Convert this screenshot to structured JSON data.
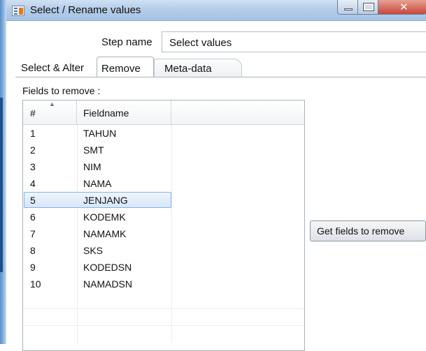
{
  "window": {
    "title": "Select / Rename values"
  },
  "step": {
    "label": "Step name",
    "value": "Select values"
  },
  "tabs": [
    {
      "label": "Select & Alter"
    },
    {
      "label": "Remove"
    },
    {
      "label": "Meta-data"
    }
  ],
  "fields_to_remove": {
    "label": "Fields to remove :",
    "columns": [
      "#",
      "Fieldname"
    ],
    "rows": [
      {
        "num": "1",
        "name": "TAHUN"
      },
      {
        "num": "2",
        "name": "SMT"
      },
      {
        "num": "3",
        "name": "NIM"
      },
      {
        "num": "4",
        "name": "NAMA"
      },
      {
        "num": "5",
        "name": "JENJANG"
      },
      {
        "num": "6",
        "name": "KODEMK"
      },
      {
        "num": "7",
        "name": "NAMAMK"
      },
      {
        "num": "8",
        "name": "SKS"
      },
      {
        "num": "9",
        "name": "KODEDSN"
      },
      {
        "num": "10",
        "name": "NAMADSN"
      }
    ],
    "selected_row": "5"
  },
  "buttons": {
    "get_fields": "Get fields to remove"
  },
  "icons": {
    "app": "transform-icon",
    "sort": "sort-ascending-icon",
    "minimize": "minimize-icon",
    "maximize": "maximize-icon",
    "close": "close-icon"
  },
  "colors": {
    "selection": "#d6e7fa",
    "titlebar": "#b4cde9"
  }
}
